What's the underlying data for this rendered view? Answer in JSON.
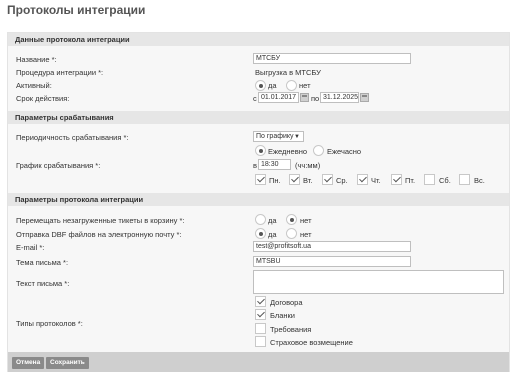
{
  "page_title": "Протоколы интеграции",
  "sections": {
    "data": "Данные протокола интеграции",
    "trigger": "Параметры срабатывания",
    "params": "Параметры протокола интеграции"
  },
  "data_fields": {
    "name_label": "Название *:",
    "name_value": "МТСБУ",
    "procedure_label": "Процедура интеграции *:",
    "procedure_value": "Выгрузка в МТСБУ",
    "active_label": "Активный:",
    "yes": "да",
    "no": "нет",
    "validity_label": "Срок действия:",
    "from_prefix": "с",
    "from_date": "01.01.2017",
    "to_prefix": "по",
    "to_date": "31.12.2025"
  },
  "trigger_fields": {
    "periodicity_label": "Периодичность срабатывания *:",
    "periodicity_value": "По графику",
    "daily": "Ежедневно",
    "weekly": "Ежечасно",
    "schedule_label": "График срабатывания *:",
    "at_prefix": "в",
    "time_value": "18:30",
    "time_format": "(чч:мм)",
    "days": [
      "Пн.",
      "Вт.",
      "Ср.",
      "Чт.",
      "Пт.",
      "Сб.",
      "Вс."
    ],
    "days_checked": [
      true,
      true,
      true,
      true,
      true,
      false,
      false
    ]
  },
  "param_fields": {
    "move_label": "Перемещать незагруженные тикеты в корзину *:",
    "send_label": "Отправка DBF файлов на электронную почту *:",
    "email_label": "E-mail *:",
    "email_value": "test@profitsoft.ua",
    "subject_label": "Тема письма *:",
    "subject_value": "MTSBU",
    "body_label": "Текст письма *:",
    "types_label": "Типы протоколов *:",
    "types": [
      "Договора",
      "Бланки",
      "Требования",
      "Страховое возмещение"
    ],
    "types_checked": [
      true,
      true,
      false,
      false
    ]
  },
  "buttons": {
    "cancel": "Отмена",
    "save": "Сохранить"
  }
}
